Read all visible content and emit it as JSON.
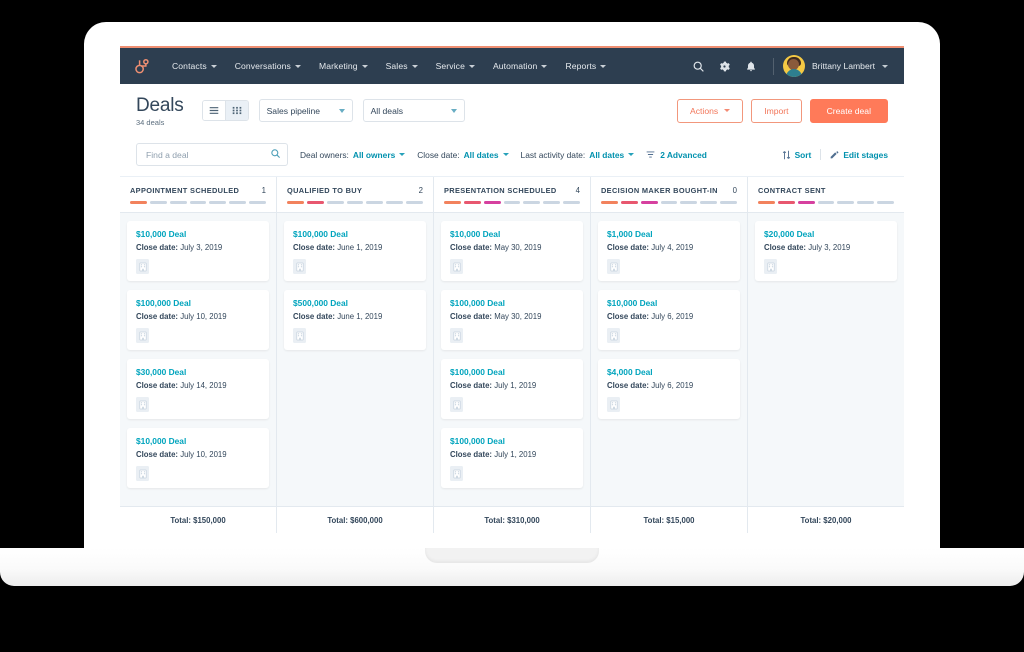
{
  "nav": {
    "logo_icon": "hubspot-sprocket-logo",
    "items": [
      {
        "label": "Contacts",
        "icon": "chevron-down-icon"
      },
      {
        "label": "Conversations",
        "icon": "chevron-down-icon"
      },
      {
        "label": "Marketing",
        "icon": "chevron-down-icon"
      },
      {
        "label": "Sales",
        "icon": "chevron-down-icon"
      },
      {
        "label": "Service",
        "icon": "chevron-down-icon"
      },
      {
        "label": "Automation",
        "icon": "chevron-down-icon"
      },
      {
        "label": "Reports",
        "icon": "chevron-down-icon"
      }
    ],
    "search_icon": "search-icon",
    "settings_icon": "gear-icon",
    "notifications_icon": "bell-icon",
    "user_name": "Brittany Lambert",
    "user_avatar": "user-avatar"
  },
  "header": {
    "title": "Deals",
    "subtitle": "34 deals",
    "view_list_icon": "list-view-icon",
    "view_board_icon": "board-view-icon",
    "pipeline_select": "Sales pipeline",
    "deals_select": "All deals",
    "actions_label": "Actions",
    "import_label": "Import",
    "create_label": "Create deal"
  },
  "filters": {
    "search_placeholder": "Find a deal",
    "search_value": "",
    "search_icon": "search-icon",
    "deal_owners_label": "Deal owners:",
    "deal_owners_value": "All owners",
    "close_date_label": "Close date:",
    "close_date_value": "All dates",
    "last_activity_label": "Last activity date:",
    "last_activity_value": "All dates",
    "advanced_label": "2 Advanced",
    "advanced_icon": "filter-list-icon",
    "sort_label": "Sort",
    "sort_icon": "sort-arrows-icon",
    "edit_stages_label": "Edit stages",
    "edit_stages_icon": "pencil-icon"
  },
  "board": {
    "segment_colors": {
      "inactive": "#cbd6e2",
      "s1": "#f2825d",
      "s2": "#e8576f",
      "s3": "#d6409f",
      "s4": "#b44ec4"
    },
    "columns": [
      {
        "name": "APPOINTMENT SCHEDULED",
        "count": "1",
        "segments_filled": 1,
        "total": "Total: $150,000",
        "cards": [
          {
            "title": "$10,000 Deal",
            "date_label": "Close date:",
            "date": "July 3, 2019",
            "icon": "company-building-icon"
          },
          {
            "title": "$100,000 Deal",
            "date_label": "Close date:",
            "date": "July 10, 2019",
            "icon": "company-building-icon"
          },
          {
            "title": "$30,000 Deal",
            "date_label": "Close date:",
            "date": "July 14, 2019",
            "icon": "company-building-icon"
          },
          {
            "title": "$10,000 Deal",
            "date_label": "Close date:",
            "date": "July 10, 2019",
            "icon": "company-building-icon"
          }
        ]
      },
      {
        "name": "QUALIFIED TO BUY",
        "count": "2",
        "segments_filled": 2,
        "total": "Total: $600,000",
        "cards": [
          {
            "title": "$100,000 Deal",
            "date_label": "Close date:",
            "date": "June 1, 2019",
            "icon": "company-building-icon"
          },
          {
            "title": "$500,000 Deal",
            "date_label": "Close date:",
            "date": "June 1, 2019",
            "icon": "company-building-icon"
          }
        ]
      },
      {
        "name": "PRESENTATION SCHEDULED",
        "count": "4",
        "segments_filled": 3,
        "total": "Total: $310,000",
        "cards": [
          {
            "title": "$10,000 Deal",
            "date_label": "Close date:",
            "date": "May 30, 2019",
            "icon": "company-building-icon"
          },
          {
            "title": "$100,000 Deal",
            "date_label": "Close date:",
            "date": "May 30, 2019",
            "icon": "company-building-icon"
          },
          {
            "title": "$100,000 Deal",
            "date_label": "Close date:",
            "date": "July 1, 2019",
            "icon": "company-building-icon"
          },
          {
            "title": "$100,000 Deal",
            "date_label": "Close date:",
            "date": "July 1, 2019",
            "icon": "company-building-icon"
          }
        ]
      },
      {
        "name": "DECISION MAKER BOUGHT-IN",
        "count": "0",
        "segments_filled": 3,
        "total": "Total: $15,000",
        "cards": [
          {
            "title": "$1,000 Deal",
            "date_label": "Close date:",
            "date": "July 4, 2019",
            "icon": "company-building-icon"
          },
          {
            "title": "$10,000 Deal",
            "date_label": "Close date:",
            "date": "July 6, 2019",
            "icon": "company-building-icon"
          },
          {
            "title": "$4,000 Deal",
            "date_label": "Close date:",
            "date": "July 6, 2019",
            "icon": "company-building-icon"
          }
        ]
      },
      {
        "name": "CONTRACT SENT",
        "count": "",
        "segments_filled": 3,
        "total": "Total: $20,000",
        "cards": [
          {
            "title": "$20,000 Deal",
            "date_label": "Close date:",
            "date": "July 3, 2019",
            "icon": "company-building-icon"
          }
        ]
      }
    ]
  }
}
